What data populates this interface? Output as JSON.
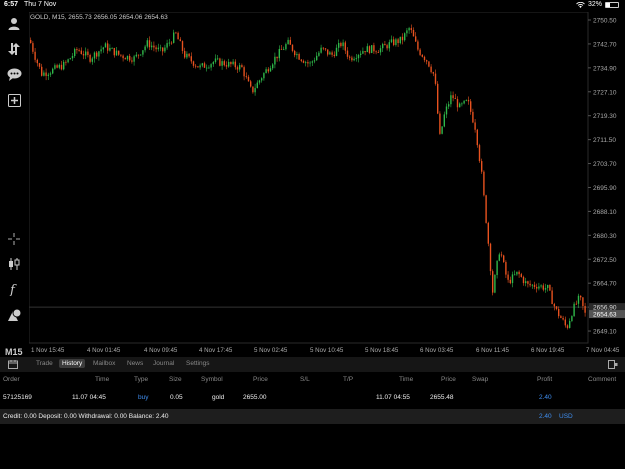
{
  "statusbar": {
    "time": "6:57",
    "date": "Thu 7 Nov",
    "battery": "32%",
    "battery_level": 0.32
  },
  "chart": {
    "info": "GOLD, M15, 2655.73 2656.05 2654.06 2654.63",
    "current_price": "2654.63",
    "bid_line": "2656.90",
    "price_labels": [
      "2750.50",
      "2742.70",
      "2734.90",
      "2727.10",
      "2719.30",
      "2711.50",
      "2703.70",
      "2695.90",
      "2688.10",
      "2680.30",
      "2672.50",
      "2664.70",
      "2656.90",
      "2649.10"
    ],
    "time_labels": [
      "1 Nov 15:45",
      "4 Nov 01:45",
      "4 Nov 09:45",
      "4 Nov 17:45",
      "5 Nov 02:45",
      "5 Nov 10:45",
      "5 Nov 18:45",
      "6 Nov 03:45",
      "6 Nov 11:45",
      "6 Nov 19:45",
      "7 Nov 04:45"
    ],
    "colors": {
      "bull": "#2fb84a",
      "bear": "#e8521f",
      "grid": "#1a1a1a",
      "price_line": "#333333"
    }
  },
  "toolbar": {
    "items": [
      "person-icon",
      "order-arrows-icon",
      "chat-icon",
      "add-chart-icon",
      "crosshair-icon",
      "candles-icon",
      "indicator-f-icon",
      "objects-icon"
    ],
    "timeframe": "M15"
  },
  "tabs": {
    "items": [
      "Trade",
      "History",
      "Mailbox",
      "News",
      "Journal",
      "Settings"
    ],
    "active": "History"
  },
  "columns": [
    "Order",
    "Time",
    "Type",
    "Size",
    "Symbol",
    "Price",
    "S/L",
    "T/P",
    "Time",
    "Price",
    "Swap",
    "Profit",
    "Comment"
  ],
  "row": {
    "order": "57125169",
    "time": "11.07 04:45",
    "type": "buy",
    "size": "0.05",
    "symbol": "gold",
    "price": "2655.00",
    "sl": "",
    "tp": "",
    "close_time": "11.07 04:55",
    "close_price": "2655.48",
    "swap": "",
    "profit": "2.40",
    "comment": ""
  },
  "footer": {
    "summary": "Credit: 0.00 Deposit: 0.00 Withdrawal: 0.00 Balance: 2.40",
    "total": "2.40",
    "currency": "USD"
  }
}
